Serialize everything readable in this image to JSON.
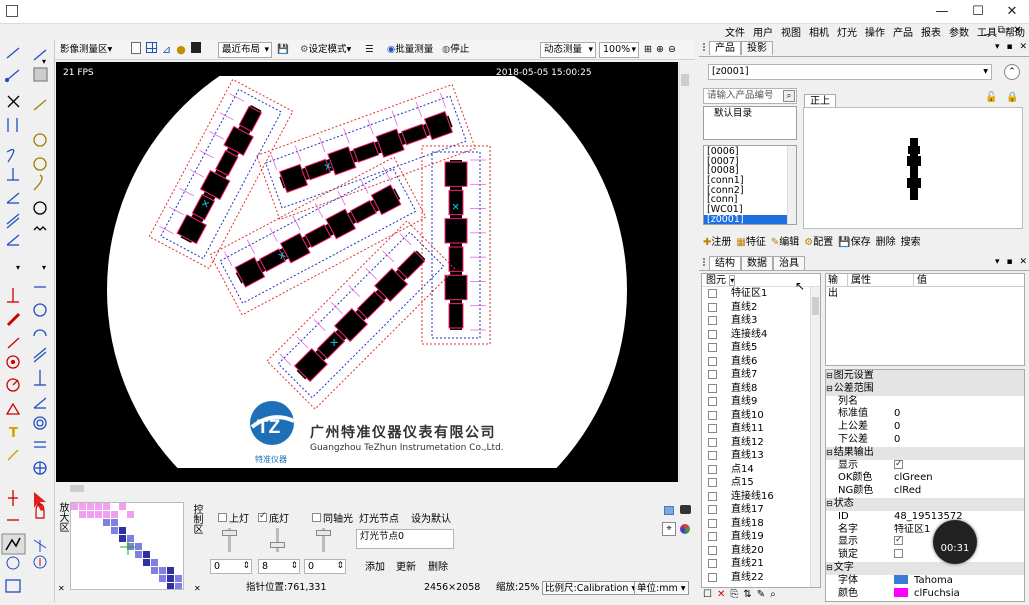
{
  "window": {
    "controls": {
      "minimize": "—",
      "maximize": "☐",
      "close": "✕"
    }
  },
  "menu": [
    "文件",
    "用户",
    "视图",
    "相机",
    "灯光",
    "操作",
    "产品",
    "报表",
    "参数",
    "工具",
    "帮助"
  ],
  "toolbar": {
    "measure_area": "影像测量区",
    "recent_layout": "最近布局",
    "setup_mode": "设定模式",
    "batch_measure": "批量测量",
    "stop": "停止",
    "dynamic_measure": "动态测量",
    "zoom": "100%"
  },
  "viewport": {
    "fps": "21 FPS",
    "timestamp": "2018-05-05 15:00:25",
    "company_cn": "广州特准仪器仪表有限公司",
    "company_en": "Guangzhou TeZhun Instrumetation Co.,Ltd.",
    "logo_caption": "特准仪器",
    "logo_letters": "TZ"
  },
  "bottom": {
    "magnify_label": "放大区",
    "control_label": "控制区",
    "checkboxes": [
      {
        "label": "上灯",
        "checked": false
      },
      {
        "label": "底灯",
        "checked": true
      },
      {
        "label": "同轴光",
        "checked": false
      }
    ],
    "light_node_label": "灯光节点",
    "set_default": "设为默认",
    "light_node_value": "灯光节点0",
    "slider_values": [
      "0",
      "8",
      "0"
    ],
    "add": "添加",
    "update": "更新",
    "delete": "删除",
    "status": {
      "pointer": "指针位置:761,331",
      "resolution": "2456×2058",
      "scale": "缩放:25%",
      "ratio": "比例尺:Calibration",
      "unit": "单位:mm"
    }
  },
  "product_panel": {
    "tabs": [
      "产品",
      "投影"
    ],
    "product_select": "[z0001]",
    "search_placeholder": "请输入产品编号",
    "default_dir": "默认目录",
    "preview_tab": "正上",
    "product_list": [
      "[0006]",
      "[0007]",
      "[0008]",
      "[conn1]",
      "[conn2]",
      "[conn]",
      "[WC01]",
      "[z0001]"
    ],
    "selected_product": "[z0001]",
    "actions": [
      "注册",
      "特征",
      "编辑",
      "配置",
      "保存",
      "删除",
      "搜索"
    ]
  },
  "structure_panel": {
    "tabs": [
      "结构",
      "数据",
      "治具"
    ],
    "tree_header": "图元",
    "items": [
      "特征区1",
      "直线2",
      "直线3",
      "连接线4",
      "直线5",
      "直线6",
      "直线7",
      "直线8",
      "直线9",
      "直线10",
      "直线11",
      "直线12",
      "直线13",
      "点14",
      "点15",
      "连接线16",
      "直线17",
      "直线18",
      "直线19",
      "直线20",
      "直线21",
      "直线22"
    ],
    "prop_headers": [
      "输出",
      "属性",
      "值"
    ],
    "props": [
      {
        "section": "图元设置"
      },
      {
        "section": "公差范围"
      },
      {
        "k": "列名",
        "v": ""
      },
      {
        "k": "标准值",
        "v": "0"
      },
      {
        "k": "上公差",
        "v": "0"
      },
      {
        "k": "下公差",
        "v": "0"
      },
      {
        "section": "结果输出"
      },
      {
        "k": "显示",
        "v": "✓"
      },
      {
        "k": "OK颜色",
        "v": "clGreen"
      },
      {
        "k": "NG颜色",
        "v": "clRed"
      },
      {
        "section": "状态"
      },
      {
        "k": "ID",
        "v": "48_19513572"
      },
      {
        "k": "名字",
        "v": "特征区1"
      },
      {
        "k": "显示",
        "v": "✓"
      },
      {
        "k": "锁定",
        "v": ""
      },
      {
        "section": "文字"
      },
      {
        "k": "字体",
        "v": "Tahoma"
      },
      {
        "k": "颜色",
        "v": "clFuchsia"
      }
    ],
    "timer": "00:31"
  }
}
